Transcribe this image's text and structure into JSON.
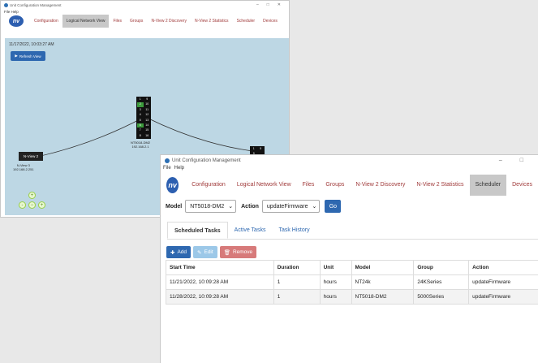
{
  "background_window": {
    "title": "Unit Configuration Management",
    "menu": "File  Help",
    "logo": "nv",
    "tabs": [
      "Configuration",
      "Logical Network View",
      "Files",
      "Groups",
      "N-View 2 Discovery",
      "N-View 2 Statistics",
      "Scheduler",
      "Devices"
    ],
    "active_tab": "Logical Network View",
    "timestamp": "11/17/2022, 10:03:27 AM",
    "refresh_label": "Refresh View",
    "devices": {
      "switch_ports": [
        "1",
        "9",
        "17",
        "2",
        "10",
        "18",
        "3",
        "11",
        "4",
        "12",
        "5",
        "13",
        "6",
        "14",
        "7",
        "15",
        "8",
        "16"
      ],
      "switch_name": "NT5018-DM2",
      "switch_ip": "192.168.2.1",
      "nview_label": "N-View 2",
      "nview_name": "N-View 3",
      "nview_ip": "192.168.2.251",
      "small_ports": [
        "1",
        "5",
        "9"
      ]
    },
    "zoom_controls": [
      "+",
      "-",
      "−",
      "+"
    ]
  },
  "front_window": {
    "title": "Unit Configuration Management",
    "menu": [
      "File",
      "Help"
    ],
    "logo": "nv",
    "tabs": [
      "Configuration",
      "Logical Network View",
      "Files",
      "Groups",
      "N-View 2 Discovery",
      "N-View 2 Statistics",
      "Scheduler",
      "Devices"
    ],
    "active_tab": "Scheduler",
    "model_label": "Model",
    "model_value": "NT5018-DM2",
    "action_label": "Action",
    "action_value": "updateFirmware",
    "go_label": "Go",
    "subtabs": [
      "Scheduled Tasks",
      "Active Tasks",
      "Task History"
    ],
    "active_subtab": "Scheduled Tasks",
    "buttons": {
      "add": "Add",
      "edit": "Edit",
      "remove": "Remove"
    },
    "table": {
      "columns": [
        "Start Time",
        "Duration",
        "Unit",
        "Model",
        "Group",
        "Action"
      ],
      "rows": [
        [
          "11/21/2022, 10:09:28 AM",
          "1",
          "hours",
          "NT24k",
          "24KSeries",
          "updateFirmware"
        ],
        [
          "11/28/2022, 10:09:28 AM",
          "1",
          "hours",
          "NT5018-DM2",
          "5000Series",
          "updateFirmware"
        ]
      ]
    }
  },
  "colors": {
    "accent": "#2e68b0",
    "tab_text": "#a03a3a",
    "canvas": "#bdd7e4",
    "remove": "#d77a7a",
    "edit": "#9cc8e8"
  }
}
